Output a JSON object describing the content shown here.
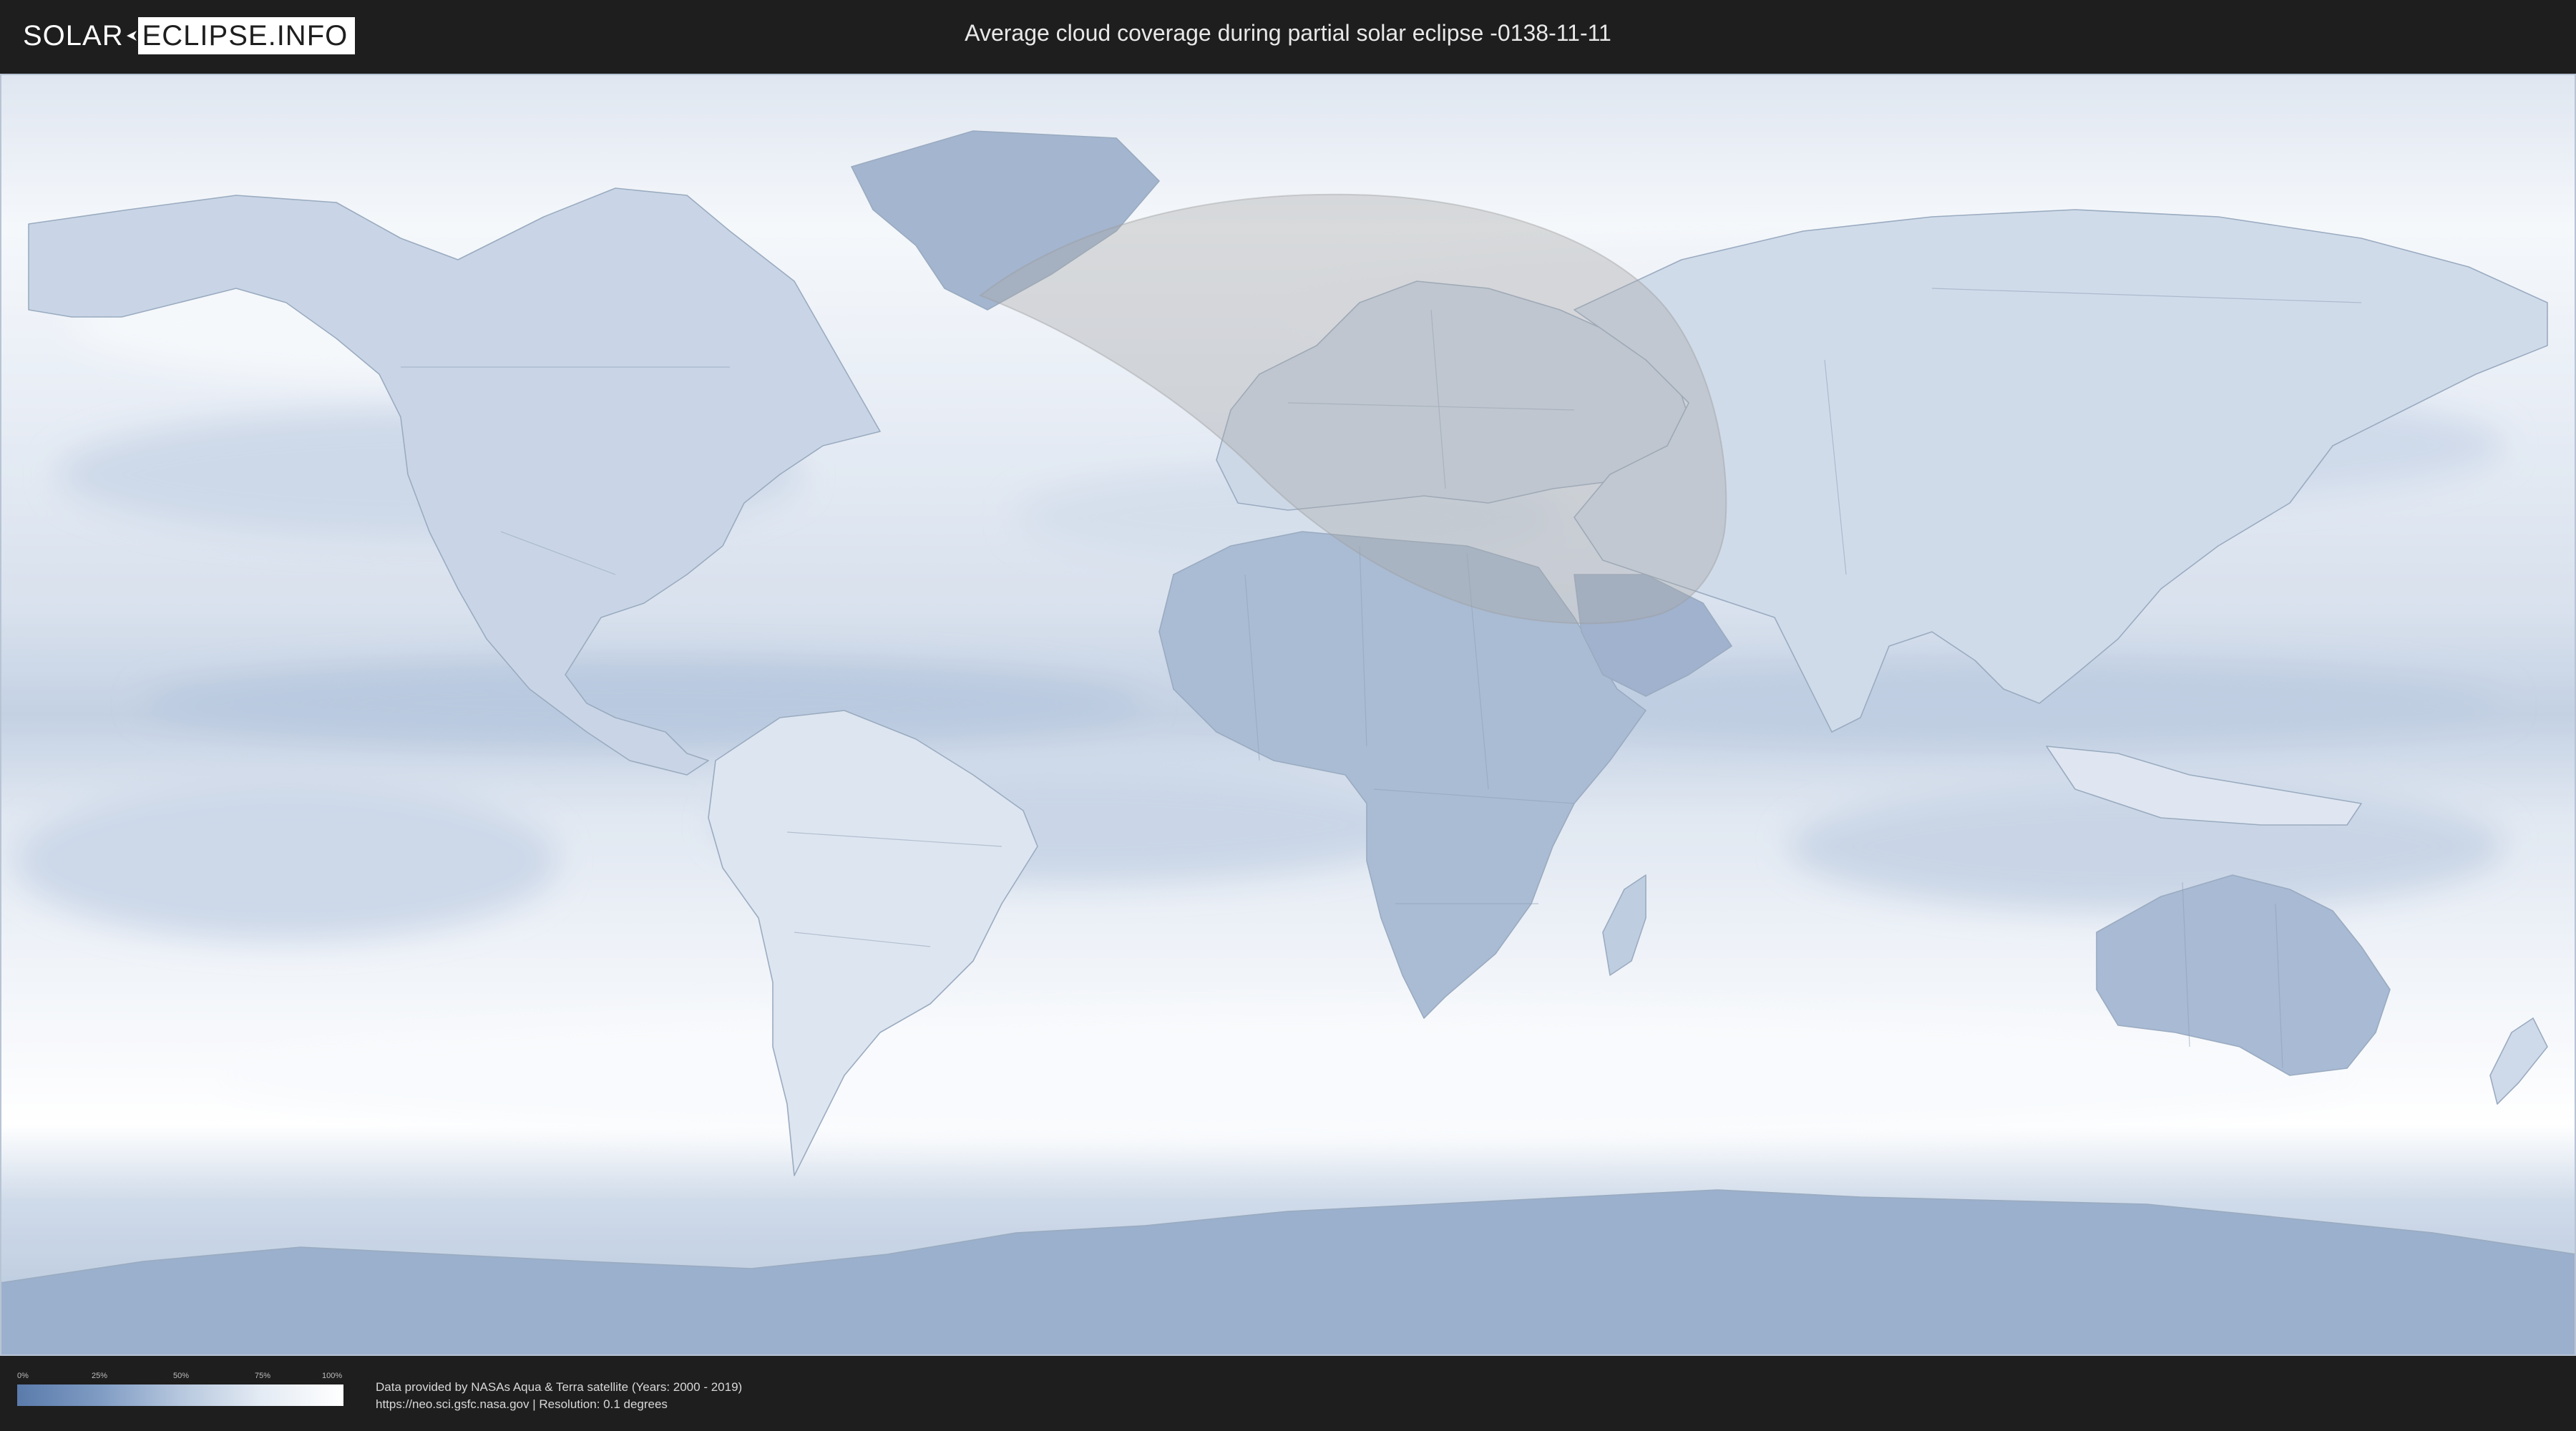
{
  "header": {
    "logo_left": "SOLAR",
    "logo_right": "ECLIPSE.INFO",
    "title": "Average cloud coverage during partial solar eclipse -0138-11-11"
  },
  "legend": {
    "ticks": [
      "0%",
      "25%",
      "50%",
      "75%",
      "100%"
    ],
    "colors": [
      "#5a7bab",
      "#7f9bc3",
      "#b6c7de",
      "#e4ebf4",
      "#ffffff"
    ]
  },
  "footer": {
    "credit_line1": "Data provided by NASAs Aqua & Terra satellite (Years: 2000 - 2019)",
    "credit_line2": "https://neo.sci.gsfc.nasa.gov | Resolution: 0.1 degrees"
  },
  "map": {
    "projection": "equirectangular",
    "eclipse_type": "partial",
    "eclipse_date": "-0138-11-11",
    "colors": {
      "ocean_cloud": "#e9eef6",
      "clear_sky": "#5a7bab",
      "eclipse_shadow": "#b4b4b4"
    }
  }
}
